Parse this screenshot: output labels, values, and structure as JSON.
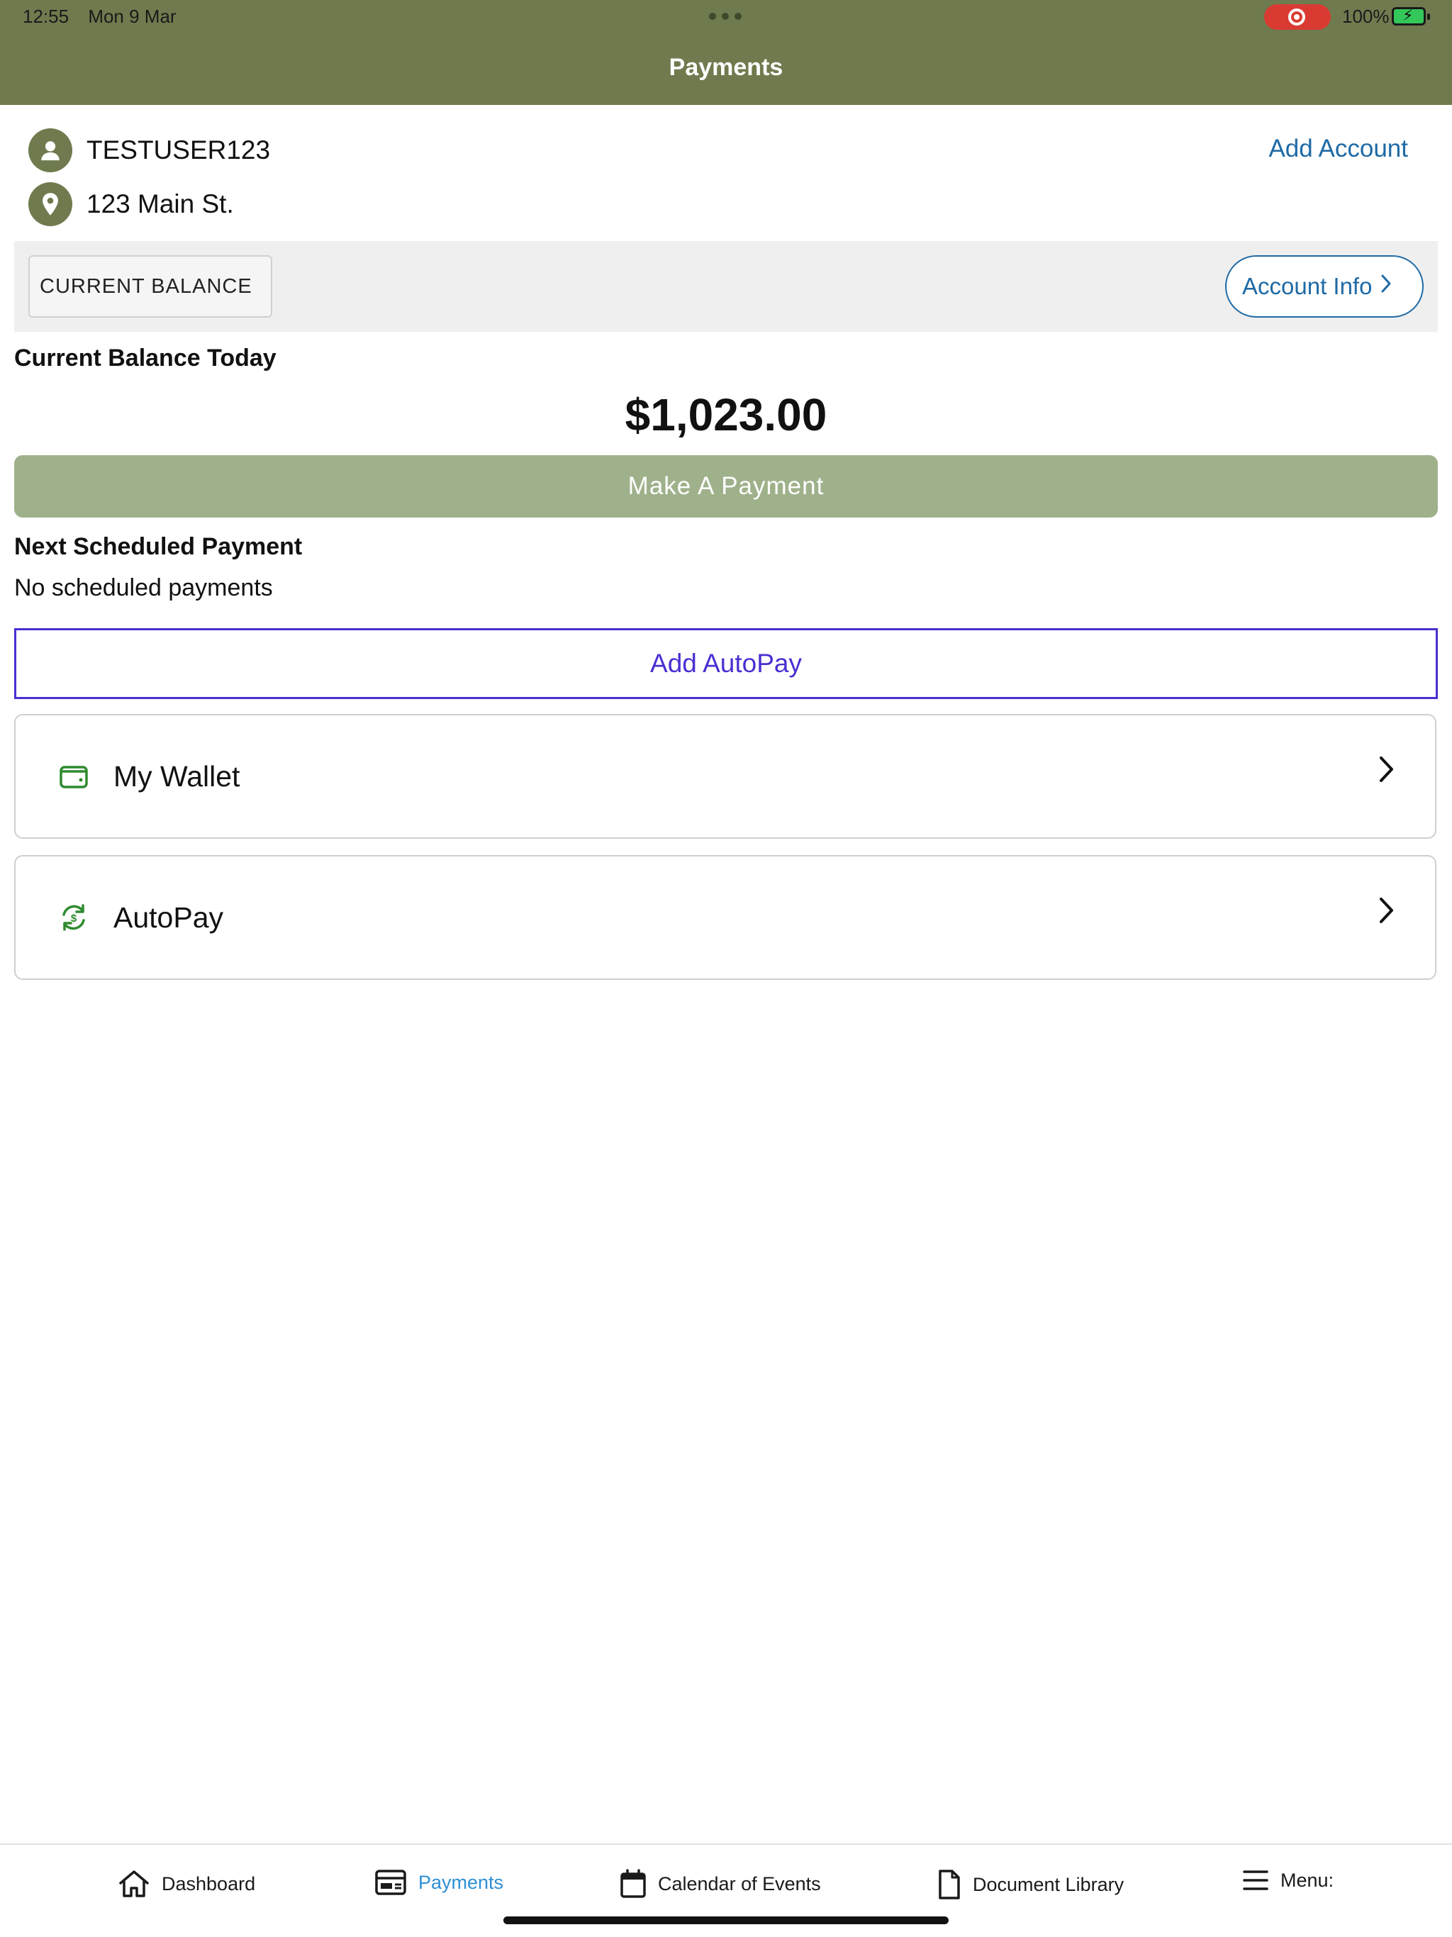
{
  "status_bar": {
    "time": "12:55",
    "date": "Mon 9 Mar",
    "battery": "100%"
  },
  "header": {
    "title": "Payments"
  },
  "account": {
    "username": "TESTUSER123",
    "address": "123 Main St.",
    "add_account_label": "Add Account"
  },
  "balance_band": {
    "chip_label": "CURRENT BALANCE",
    "account_info_label": "Account Info"
  },
  "balance": {
    "heading": "Current Balance Today",
    "amount": "$1,023.00",
    "pay_button_label": "Make A Payment"
  },
  "schedule": {
    "heading": "Next Scheduled Payment",
    "empty_text": "No scheduled payments",
    "add_autopay_label": "Add AutoPay"
  },
  "cards": [
    {
      "label": "My Wallet",
      "icon": "wallet-icon"
    },
    {
      "label": "AutoPay",
      "icon": "autopay-cycle-icon"
    }
  ],
  "tabs": [
    {
      "label": "Dashboard",
      "icon": "home-icon"
    },
    {
      "label": "Payments",
      "icon": "payments-icon",
      "active": true
    },
    {
      "label": "Calendar of Events",
      "icon": "calendar-icon"
    },
    {
      "label": "Document Library",
      "icon": "document-icon"
    },
    {
      "label": "Menu:",
      "icon": "hamburger-icon"
    }
  ],
  "colors": {
    "header_bg": "#6f7b4e",
    "pay_button": "#9fb18b",
    "link_blue": "#1f6aa5",
    "autopay_purple": "#4b2fd2",
    "active_tab": "#2d8fd5",
    "icon_green": "#2e8b2e"
  }
}
